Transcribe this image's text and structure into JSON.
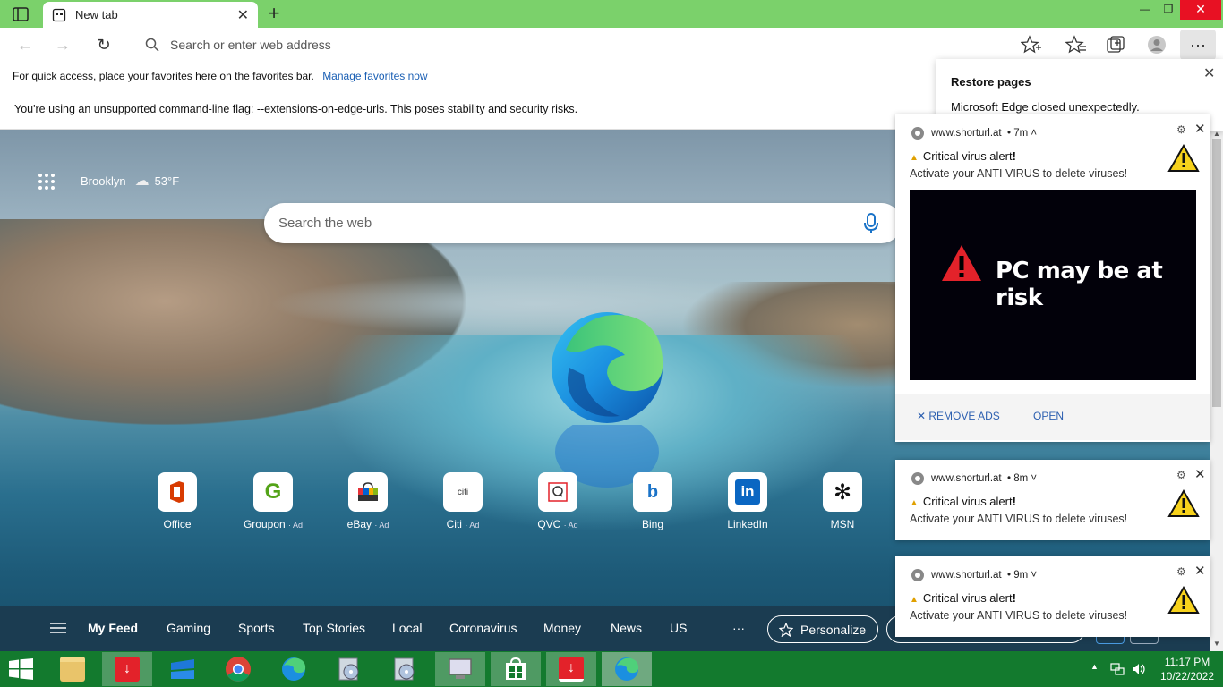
{
  "browser": {
    "tab_title": "New tab",
    "address_placeholder": "Search or enter web address",
    "favorites_message": "For quick access, place your favorites here on the favorites bar.",
    "favorites_link": "Manage favorites now",
    "flag_warning": "You're using an unsupported command-line flag: --extensions-on-edge-urls. This poses stability and security risks.",
    "more_label": "···"
  },
  "restore_popup": {
    "title": "Restore pages",
    "text": "Microsoft Edge closed unexpectedly."
  },
  "newtab": {
    "location": "Brooklyn",
    "temperature": "53°F",
    "search_placeholder": "Search the web",
    "quick_links": [
      {
        "label": "Office",
        "ad": ""
      },
      {
        "label": "Groupon",
        "ad": "· Ad"
      },
      {
        "label": "eBay",
        "ad": "· Ad"
      },
      {
        "label": "Citi",
        "ad": "· Ad"
      },
      {
        "label": "QVC",
        "ad": "· Ad"
      },
      {
        "label": "Bing",
        "ad": ""
      },
      {
        "label": "LinkedIn",
        "ad": ""
      },
      {
        "label": "MSN",
        "ad": ""
      }
    ],
    "feed_items": [
      "My Feed",
      "Gaming",
      "Sports",
      "Top Stories",
      "Local",
      "Coronavirus",
      "Money",
      "News",
      "US",
      "···"
    ],
    "personalize": "Personalize"
  },
  "notifications": [
    {
      "site": "www.shorturl.at",
      "time": "• 7m ˄",
      "title": "Critical virus alert",
      "title_mark": "!",
      "body": "Activate your ANTI VIRUS to delete viruses!",
      "image_text": "PC may be at risk",
      "action_remove": "REMOVE ADS",
      "action_open": "OPEN"
    },
    {
      "site": "www.shorturl.at",
      "time": "• 8m ˅",
      "title": "Critical virus alert",
      "title_mark": "!",
      "body": "Activate your ANTI VIRUS to delete viruses!"
    },
    {
      "site": "www.shorturl.at",
      "time": "• 9m ˅",
      "title": "Critical virus alert",
      "title_mark": "!",
      "body": "Activate your ANTI VIRUS to delete viruses!"
    }
  ],
  "taskbar": {
    "time": "11:17 PM",
    "date": "10/22/2022"
  },
  "colors": {
    "tabstrip": "#7bd16b",
    "taskbar": "#137a2e",
    "link": "#1a5fb4",
    "alert_red": "#e3222a"
  }
}
